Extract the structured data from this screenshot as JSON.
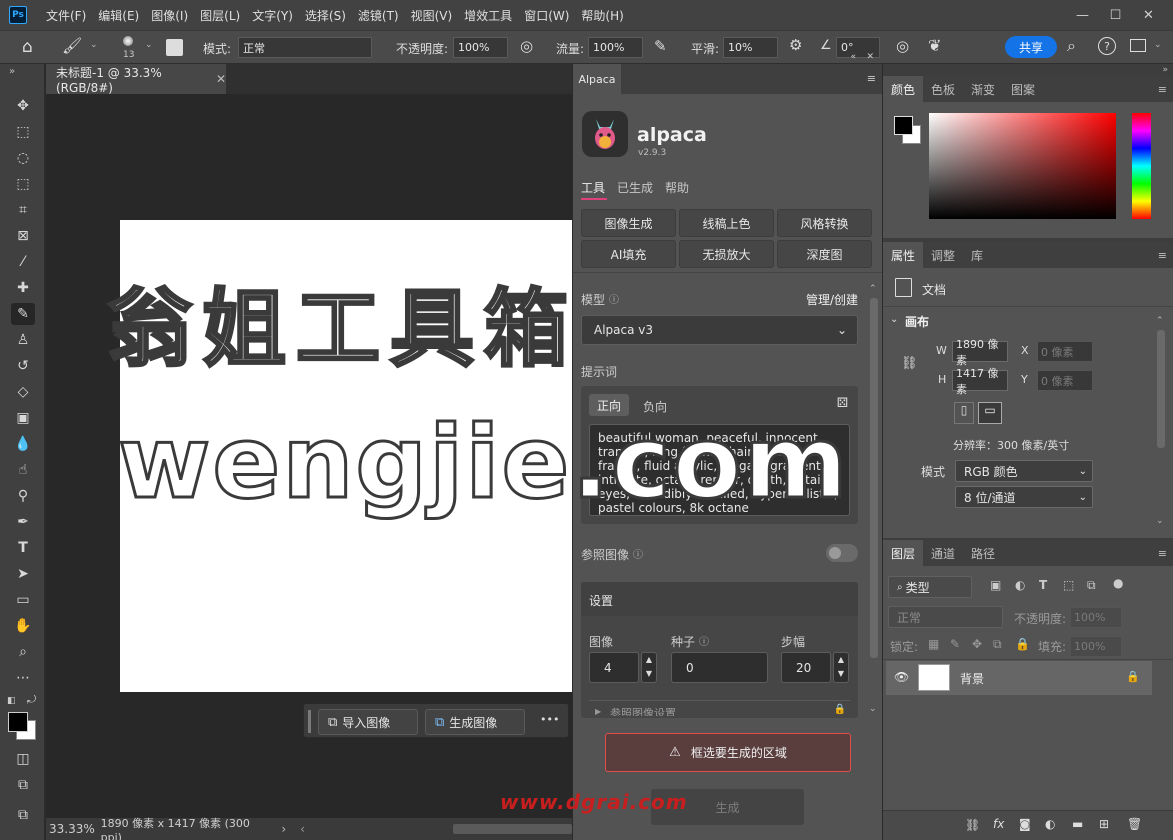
{
  "menubar": {
    "logo": "Ps",
    "items": [
      "文件(F)",
      "编辑(E)",
      "图像(I)",
      "图层(L)",
      "文字(Y)",
      "选择(S)",
      "滤镜(T)",
      "视图(V)",
      "增效工具",
      "窗口(W)",
      "帮助(H)"
    ],
    "minimize": "—",
    "maximize": "☐",
    "close": "✕"
  },
  "options": {
    "brush_size": "13",
    "mode_label": "模式:",
    "mode_value": "正常",
    "opacity_label": "不透明度:",
    "opacity_value": "100%",
    "flow_label": "流量:",
    "flow_value": "100%",
    "smooth_label": "平滑:",
    "smooth_value": "10%",
    "angle_value": "0°",
    "share": "共享"
  },
  "document": {
    "tab_title": "未标题-1 @ 33.3%(RGB/8#)",
    "zoom": "33.33%",
    "info": "1890 像素 x 1417 像素 (300 ppi)",
    "watermark_line1": "翁姐工具箱",
    "watermark_line2": "wengjie.com",
    "watermark_url": "www.dgrai.com"
  },
  "context_bar": {
    "import": "导入图像",
    "generate": "生成图像",
    "more": "•••"
  },
  "plugin": {
    "tab": "Alpaca",
    "name": "alpaca",
    "version": "v2.9.3",
    "nav": [
      "工具",
      "已生成",
      "帮助"
    ],
    "tools": [
      "图像生成",
      "线稿上色",
      "风格转换",
      "AI填充",
      "无损放大",
      "深度图"
    ],
    "model_label": "模型",
    "manage": "管理/创建",
    "model_value": "Alpaca v3",
    "prompt_label": "提示词",
    "prompt_tabs": [
      "正向",
      "负向"
    ],
    "prompt_text": "beautiful woman, peaceful, innocent, tranquil, long flowing hair, liquid rococo fractal, fluid acrylic, elegant gradients, intricate, octane render, depth, detailed eyes, incredibly detailed, hyperrealistic, pastel colours, 8k octane",
    "ref_label": "参照图像",
    "settings_label": "设置",
    "images_label": "图像",
    "images_value": "4",
    "seed_label": "种子",
    "seed_value": "0",
    "steps_label": "步幅",
    "steps_value": "20",
    "ref_settings": "参照图像设置",
    "warning": "框选要生成的区域",
    "generate": "生成"
  },
  "color_panel": {
    "tabs": [
      "颜色",
      "色板",
      "渐变",
      "图案"
    ]
  },
  "props_panel": {
    "tabs": [
      "属性",
      "调整",
      "库"
    ],
    "doc_label": "文档",
    "section": "画布",
    "w_label": "W",
    "w_value": "1890 像素",
    "h_label": "H",
    "h_value": "1417 像素",
    "x_label": "X",
    "x_value": "0 像素",
    "y_label": "Y",
    "y_value": "0 像素",
    "resolution": "分辨率：300 像素/英寸",
    "mode_label": "模式",
    "mode_value": "RGB 颜色",
    "depth_value": "8 位/通道"
  },
  "layers_panel": {
    "tabs": [
      "图层",
      "通道",
      "路径"
    ],
    "filter": "类型",
    "blend": "正常",
    "opacity_label": "不透明度:",
    "opacity_value": "100%",
    "lock_label": "锁定:",
    "fill_label": "填充:",
    "fill_value": "100%",
    "layer_name": "背景"
  },
  "colors": {
    "accent": "#1473e6",
    "ps_blue": "#31a8ff",
    "pink": "#e0407a",
    "warning_border": "#e04c4c"
  }
}
